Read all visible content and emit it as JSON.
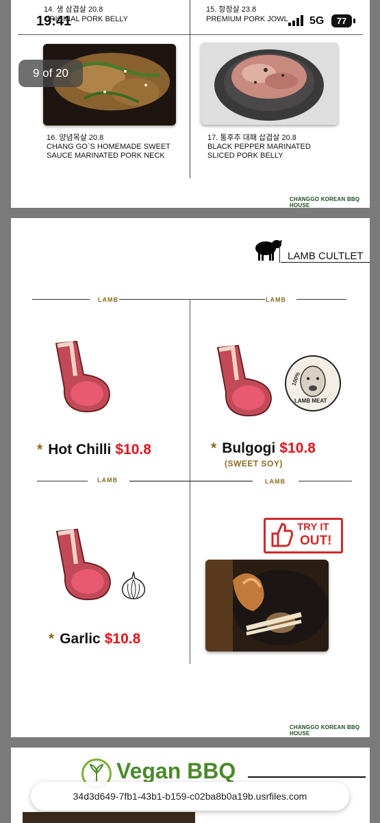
{
  "status_bar": {
    "time": "19:41",
    "network": "5G",
    "battery": "77"
  },
  "viewer": {
    "counter": "9 of 20"
  },
  "page1": {
    "item14": {
      "line1": "14. 생 삼겹살  20.8",
      "line2": "ORIGINAL PORK BELLY"
    },
    "item15": {
      "line1": "15. 항정살  23.8",
      "line2": "PREMIUM PORK JOWL"
    },
    "item16": {
      "line1": "16. 양념목살  20.8",
      "line2": "CHANG GO`S HOMEMADE SWEET",
      "line3": "SAUCE MARINATED PORK NECK"
    },
    "item17": {
      "line1": "17.  통후추 대패 삽겹살   20.8",
      "line2": "BLACK PEPPER  MARINATED",
      "line3": "SLICED PORK BELLY"
    },
    "footer": "CHANGGO KOREAN BBQ HOUSE"
  },
  "page2": {
    "section_title": "LAMB CULTLET",
    "labels": [
      "LAMB",
      "LAMB",
      "LAMB",
      "LAMB"
    ],
    "items": [
      {
        "star": "*",
        "name": "Hot Chilli",
        "price": "$10.8",
        "sub": ""
      },
      {
        "star": "*",
        "name": "Bulgogi",
        "price": "$10.8",
        "sub": "(SWEET SOY)"
      },
      {
        "star": "*",
        "name": "Garlic",
        "price": "$10.8",
        "sub": ""
      }
    ],
    "badge": {
      "top": "100%",
      "bottom": "LAMB MEAT"
    },
    "try_stamp": {
      "line1": "TRY IT",
      "line2": "OUT!"
    },
    "footer": "CHANGGO KOREAN BBQ HOUSE"
  },
  "page3": {
    "title": "Vegan BBQ"
  },
  "url_bar": {
    "url": "34d3d649-7fb1-43b1-b159-c02ba8b0a19b.usrfiles.com"
  },
  "colors": {
    "price_red": "#e8101a",
    "gold": "#8a6a20",
    "vegan_green": "#4a8a2a"
  }
}
